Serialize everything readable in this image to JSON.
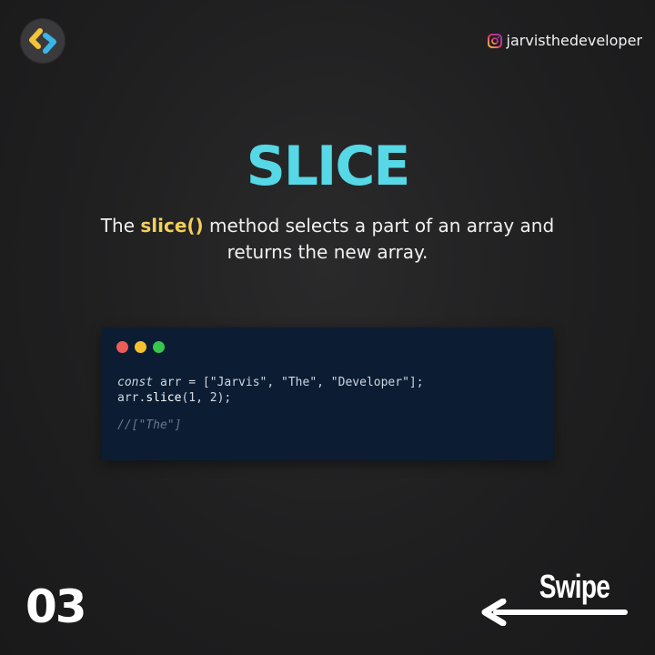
{
  "logo": {
    "icon": "code-brackets-logo-icon",
    "colors": [
      "#f3c33b",
      "#3bb6e8"
    ]
  },
  "header": {
    "handle_icon": "instagram-icon",
    "handle": "jarvisthedeveloper"
  },
  "slide": {
    "title": "SLICE",
    "description_prefix": "The ",
    "description_keyword": "slice()",
    "description_line1_rest": " method selects a part of an array and",
    "description_line2": "returns the new array."
  },
  "code_window": {
    "dots": [
      "red",
      "yellow",
      "green"
    ],
    "line1_keyword": "const",
    "line1_rest": " arr = [\"Jarvis\", \"The\", \"Developer\"];",
    "line2_obj": "arr.",
    "line2_method": "slice",
    "line2_rest": "(1, 2);",
    "comment": "//[\"The\"]"
  },
  "footer": {
    "page_number": "03",
    "swipe_label": "Swipe",
    "swipe_icon": "arrow-left-icon"
  },
  "colors": {
    "accent": "#56d8e6",
    "keyword": "#f3cf5b",
    "code_bg": "#0c1d33"
  }
}
